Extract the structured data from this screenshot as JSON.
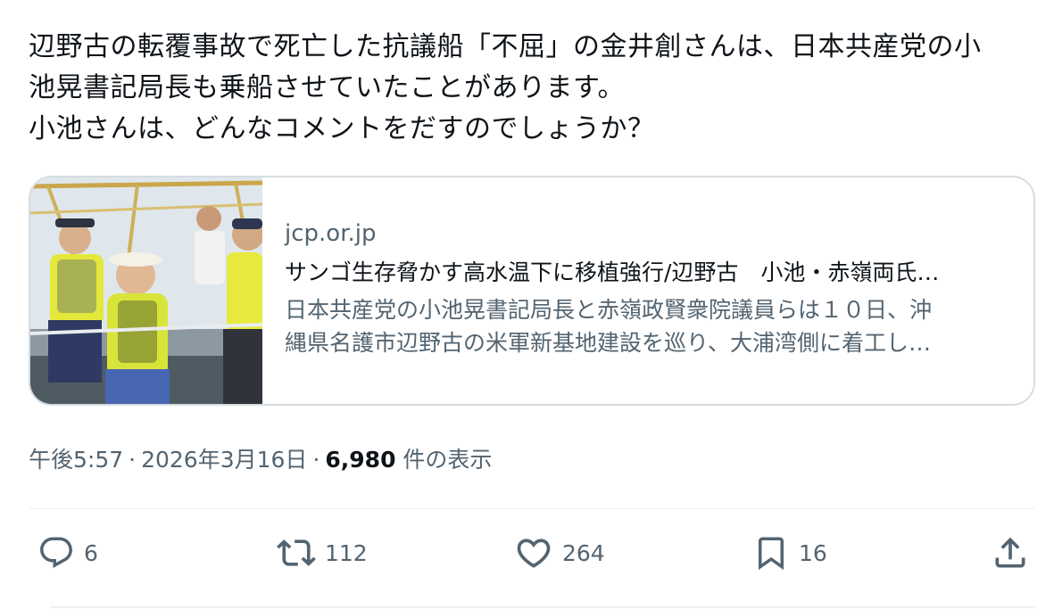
{
  "tweet": {
    "lines": [
      "辺野古の転覆事故で死亡した抗議船「不屈」の金井創さんは、日本共産党の小",
      "池晃書記局長も乗船させていたことがあります。",
      "小池さんは、どんなコメントをだすのでしょうか？"
    ]
  },
  "card": {
    "domain": "jcp.or.jp",
    "title": "サンゴ生存脅かす高水温下に移植強行/辺野古　小池・赤嶺両氏…",
    "description_lines": [
      "日本共産党の小池晃書記局長と赤嶺政賢衆院議員らは１０日、沖",
      "縄県名護市辺野古の米軍新基地建設を巡り、大浦湾側に着工し…"
    ],
    "thumbnail_icon": "boat-protest-photo"
  },
  "meta": {
    "time": "午後5:57",
    "separator": "·",
    "date": "2026年3月16日",
    "views_count": "6,980",
    "views_label": "件の表示"
  },
  "actions": {
    "reply": {
      "icon": "reply-icon",
      "count": "6"
    },
    "retweet": {
      "icon": "retweet-icon",
      "count": "112"
    },
    "like": {
      "icon": "heart-icon",
      "count": "264"
    },
    "bookmark": {
      "icon": "bookmark-icon",
      "count": "16"
    },
    "share": {
      "icon": "share-icon"
    }
  },
  "colors": {
    "text_primary": "#0f1419",
    "text_secondary": "#536471",
    "border": "#d6dde2"
  }
}
